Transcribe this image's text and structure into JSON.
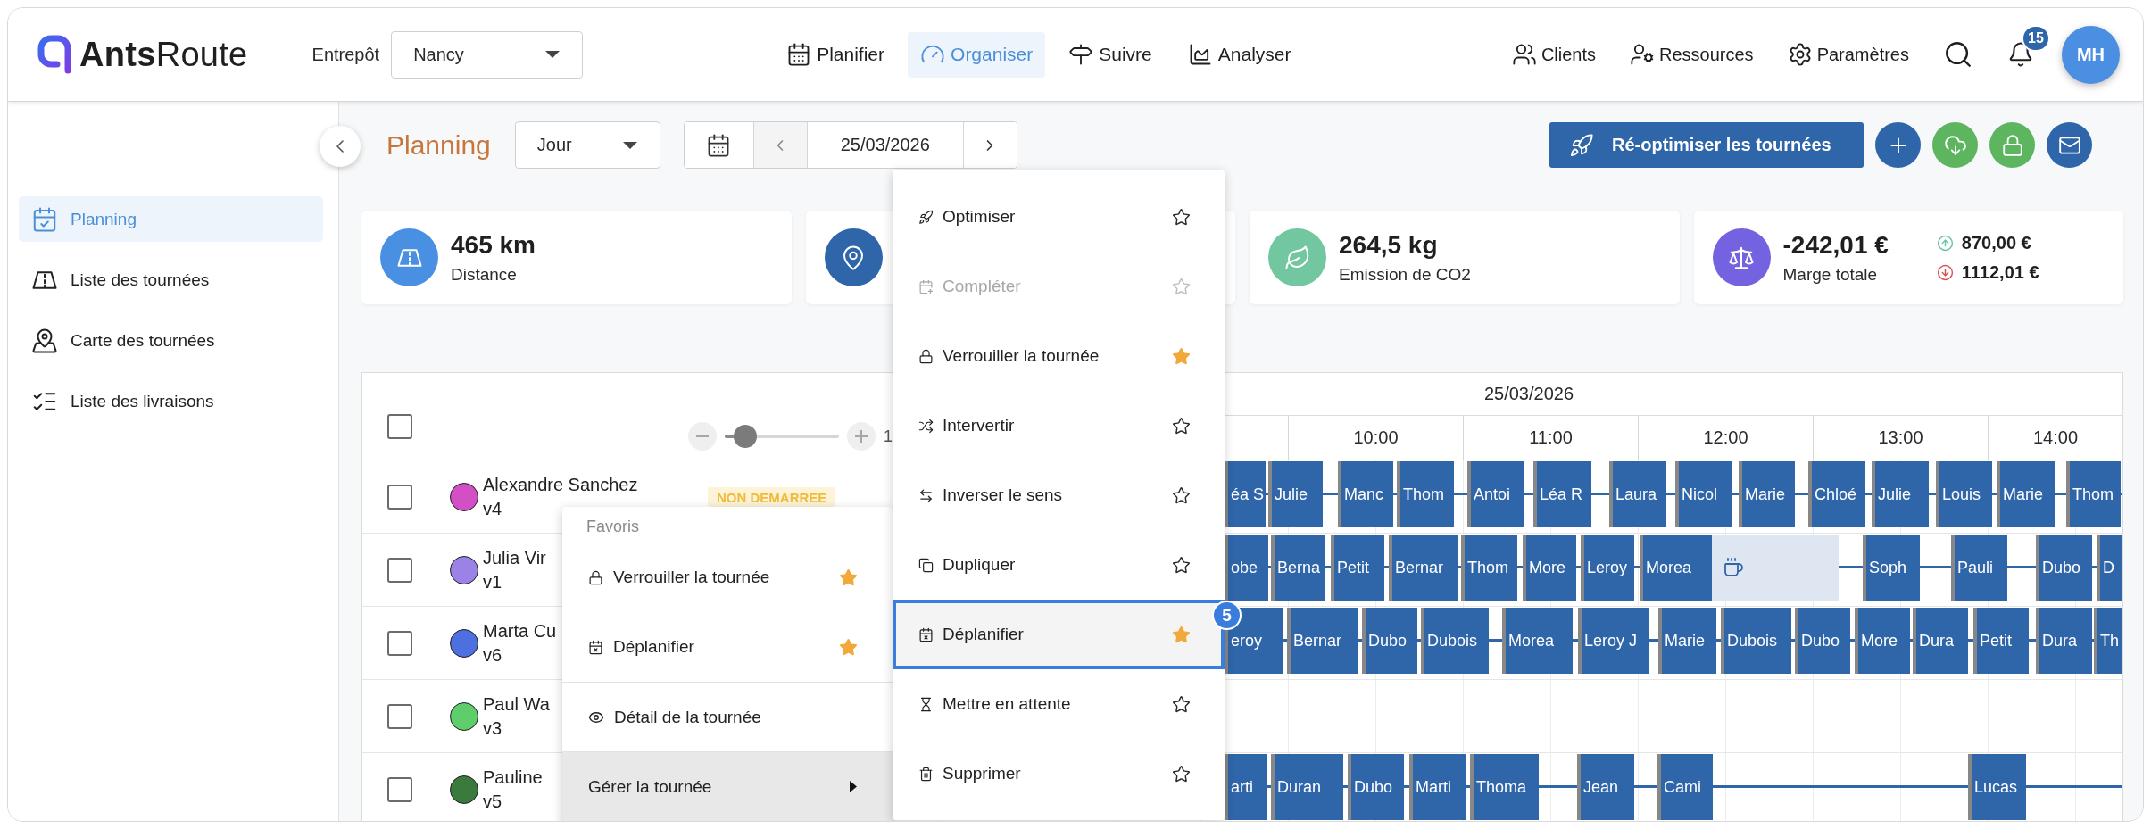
{
  "header": {
    "logo": "**Ants**Route",
    "warehouse_label": "Entrepôt",
    "warehouse": "Nancy",
    "nav": [
      {
        "label": "Planifier",
        "selected": false
      },
      {
        "label": "Organiser",
        "selected": true
      },
      {
        "label": "Suivre",
        "selected": false
      },
      {
        "label": "Analyser",
        "selected": false
      }
    ],
    "links": [
      "Clients",
      "Ressources",
      "Paramètres"
    ],
    "notifications": "15",
    "avatar": "MH"
  },
  "sidebar": {
    "items": [
      {
        "label": "Planning",
        "selected": true
      },
      {
        "label": "Liste des tournées",
        "selected": false
      },
      {
        "label": "Carte des tournées",
        "selected": false
      },
      {
        "label": "Liste des livraisons",
        "selected": false
      }
    ]
  },
  "toolbar": {
    "title": "Planning",
    "view": "Jour",
    "date": "25/03/2026",
    "primary_action": "Ré-optimiser les tournées",
    "icon_actions": [
      {
        "color": "#2f65a9"
      },
      {
        "color": "#5db560"
      },
      {
        "color": "#5db560"
      },
      {
        "color": "#2f65a9"
      }
    ]
  },
  "stats": [
    {
      "color": "#4a90e2",
      "value": "465 km",
      "label": "Distance"
    },
    {
      "color": "#2f65a9"
    },
    {
      "color": "#72c6a0",
      "value": "264,5 kg",
      "label": "Emission de CO2"
    },
    {
      "color": "#7463e0",
      "value": "-242,01 €",
      "label": "Marge totale",
      "breakdown": [
        {
          "kind": "up",
          "value": "870,00 €"
        },
        {
          "kind": "down",
          "value": "1112,01 €"
        }
      ]
    }
  ],
  "table": {
    "select_all": {
      "checked": false
    },
    "zoom": {
      "level": 0.18,
      "label": "1"
    },
    "date": "25/03/2026",
    "hours": [
      "10:00",
      "11:00",
      "12:00",
      "13:00",
      "14:00"
    ],
    "rows": [
      {
        "name": "Alexandre Sanchez",
        "vehicle": "v4",
        "color": "#d24fc6",
        "checked": false,
        "status": "NON DEMARREE",
        "bars": [
          {
            "kind": "stop",
            "label": "éa S"
          },
          {
            "kind": "stop",
            "label": "Julie"
          },
          {
            "kind": "stop",
            "label": "Manc"
          },
          {
            "kind": "stop",
            "label": "Thom"
          },
          {
            "kind": "stop",
            "label": "Antoi"
          },
          {
            "kind": "stop",
            "label": "Léa R"
          },
          {
            "kind": "stop",
            "label": "Laura"
          },
          {
            "kind": "stop",
            "label": "Nicol"
          },
          {
            "kind": "stop",
            "label": "Marie"
          },
          {
            "kind": "stop",
            "label": "Chloé"
          },
          {
            "kind": "stop",
            "label": "Julie"
          },
          {
            "kind": "stop",
            "label": "Louis"
          },
          {
            "kind": "stop",
            "label": "Marie"
          },
          {
            "kind": "stop",
            "label": "Thom"
          }
        ]
      },
      {
        "name": "Julia Vir",
        "vehicle": "v1",
        "color": "#9b82e6",
        "checked": false,
        "bars": [
          {
            "kind": "stop",
            "label": "obe"
          },
          {
            "kind": "stop",
            "label": "Berna"
          },
          {
            "kind": "stop",
            "label": "Petit"
          },
          {
            "kind": "stop",
            "label": "Bernar"
          },
          {
            "kind": "stop",
            "label": "Thom"
          },
          {
            "kind": "stop",
            "label": "More"
          },
          {
            "kind": "stop",
            "label": "Leroy"
          },
          {
            "kind": "stop",
            "label": "Morea"
          },
          {
            "kind": "break"
          },
          {
            "kind": "stop",
            "label": "Soph"
          },
          {
            "kind": "stop",
            "label": "Pauli"
          },
          {
            "kind": "stop",
            "label": "Dubo"
          },
          {
            "kind": "stop",
            "label": "D"
          }
        ]
      },
      {
        "name": "Marta Cu",
        "vehicle": "v6",
        "color": "#4d6fe0",
        "checked": false,
        "bars": [
          {
            "kind": "stop",
            "label": "eroy"
          },
          {
            "kind": "stop",
            "label": "Bernar"
          },
          {
            "kind": "stop",
            "label": "Dubo"
          },
          {
            "kind": "stop",
            "label": "Dubois"
          },
          {
            "kind": "stop",
            "label": "Morea"
          },
          {
            "kind": "stop",
            "label": "Leroy J"
          },
          {
            "kind": "stop",
            "label": "Marie"
          },
          {
            "kind": "stop",
            "label": "Dubois"
          },
          {
            "kind": "stop",
            "label": "Dubo"
          },
          {
            "kind": "stop",
            "label": "More"
          },
          {
            "kind": "stop",
            "label": "Dura"
          },
          {
            "kind": "stop",
            "label": "Petit"
          },
          {
            "kind": "stop",
            "label": "Dura"
          },
          {
            "kind": "stop",
            "label": "Th"
          }
        ]
      },
      {
        "name": "Paul Wa",
        "vehicle": "v3",
        "color": "#5fcd6b",
        "checked": false
      },
      {
        "name": "Pauline",
        "vehicle": "v5",
        "color": "#3a7a3d",
        "checked": false,
        "bars": [
          {
            "kind": "stop",
            "label": "arti"
          },
          {
            "kind": "stop",
            "label": "Duran"
          },
          {
            "kind": "stop",
            "label": "Dubo"
          },
          {
            "kind": "stop",
            "label": "Marti"
          },
          {
            "kind": "stop",
            "label": "Thoma"
          },
          {
            "kind": "stop",
            "label": "Jean"
          },
          {
            "kind": "stop",
            "label": "Cami"
          },
          {
            "kind": "stop",
            "label": "Lucas"
          }
        ]
      }
    ]
  },
  "context_menu": {
    "title": "Favoris",
    "favorites": [
      {
        "label": "Verrouiller la tournée",
        "favorite": true
      },
      {
        "label": "Déplanifier",
        "favorite": true
      }
    ],
    "items": [
      {
        "label": "Détail de la tournée",
        "kind": "action",
        "selected": false
      },
      {
        "label": "Gérer la tournée",
        "kind": "submenu",
        "selected": true
      }
    ]
  },
  "submenu": {
    "step": "5",
    "items": [
      {
        "label": "Optimiser",
        "favorite": false,
        "disabled": false,
        "selected": false
      },
      {
        "label": "Compléter",
        "favorite": false,
        "disabled": true,
        "selected": false
      },
      {
        "label": "Verrouiller la tournée",
        "favorite": true,
        "disabled": false,
        "selected": false
      },
      {
        "label": "Intervertir",
        "favorite": false,
        "disabled": false,
        "selected": false
      },
      {
        "label": "Inverser le sens",
        "favorite": false,
        "disabled": false,
        "selected": false
      },
      {
        "label": "Dupliquer",
        "favorite": false,
        "disabled": false,
        "selected": false
      },
      {
        "label": "Déplanifier",
        "favorite": true,
        "disabled": false,
        "selected": true
      },
      {
        "label": "Mettre en attente",
        "favorite": false,
        "disabled": false,
        "selected": false
      },
      {
        "label": "Supprimer",
        "favorite": false,
        "disabled": false,
        "selected": false
      }
    ]
  }
}
